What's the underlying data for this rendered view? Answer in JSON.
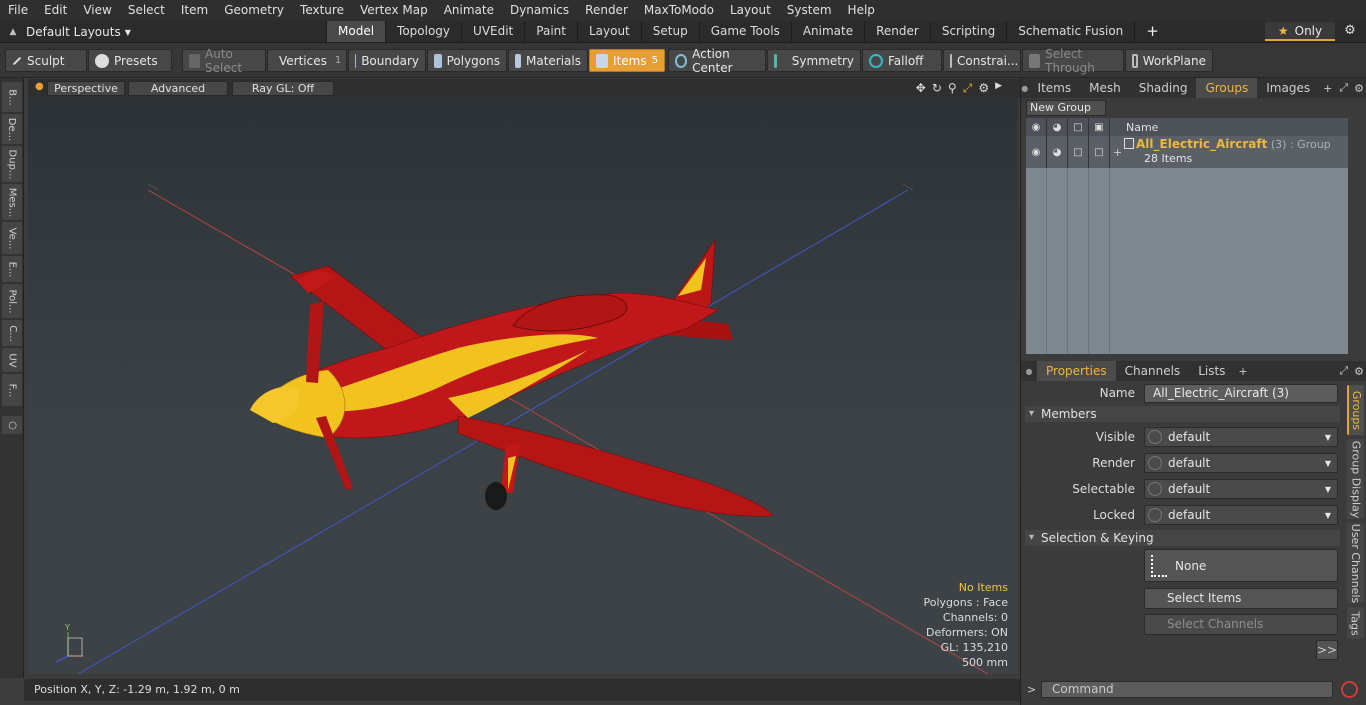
{
  "menu": [
    "File",
    "Edit",
    "View",
    "Select",
    "Item",
    "Geometry",
    "Texture",
    "Vertex Map",
    "Animate",
    "Dynamics",
    "Render",
    "MaxToModo",
    "Layout",
    "System",
    "Help"
  ],
  "layout_selector": "Default Layouts",
  "mode_tabs": [
    "Model",
    "Topology",
    "UVEdit",
    "Paint",
    "Layout",
    "Setup",
    "Game Tools",
    "Animate",
    "Render",
    "Scripting",
    "Schematic Fusion"
  ],
  "active_mode_tab": "Model",
  "only_label": "Only",
  "toolbar": {
    "sculpt": "Sculpt",
    "presets": "Presets",
    "auto_select": "Auto Select",
    "vertices": "Vertices",
    "vertices_count": "1",
    "boundary": "Boundary",
    "polygons": "Polygons",
    "materials": "Materials",
    "items": "Items",
    "items_count": "5",
    "action_center": "Action Center",
    "symmetry": "Symmetry",
    "falloff": "Falloff",
    "constraints": "Constrai...",
    "select_through": "Select Through",
    "workplane": "WorkPlane"
  },
  "left_tabs": [
    "B...",
    "De...",
    "Dup...",
    "Mes...",
    "Ve...",
    "E...",
    "Pol...",
    "C...",
    "UV",
    "F..."
  ],
  "viewport": {
    "perspective": "Perspective",
    "advanced": "Advanced",
    "raygl": "Ray GL: Off",
    "stats": {
      "items": "No Items",
      "polygons": "Polygons : Face",
      "channels": "Channels: 0",
      "deformers": "Deformers: ON",
      "gl": "GL: 135,210",
      "scale": "500 mm"
    }
  },
  "status": {
    "position": "Position X, Y, Z:   -1.29 m, 1.92 m, 0 m"
  },
  "right_tabs": [
    "Items",
    "Mesh ...",
    "Shading",
    "Groups",
    "Images"
  ],
  "active_right_tab": "Groups",
  "groups": {
    "new_group": "New Group",
    "name_header": "Name",
    "group_name": "All_Electric_Aircraft",
    "group_count": "(3)",
    "group_type": ": Group",
    "group_items": "28 Items"
  },
  "prop_tabs": [
    "Properties",
    "Channels",
    "Lists"
  ],
  "active_prop_tab": "Properties",
  "properties": {
    "name_label": "Name",
    "name_value": "All_Electric_Aircraft (3)",
    "members_section": "Members",
    "visible_label": "Visible",
    "visible_value": "default",
    "render_label": "Render",
    "render_value": "default",
    "selectable_label": "Selectable",
    "selectable_value": "default",
    "locked_label": "Locked",
    "locked_value": "default",
    "sel_keying_section": "Selection & Keying",
    "none_label": "None",
    "select_items": "Select Items",
    "select_channels": "Select Channels",
    "more": ">>"
  },
  "prop_vtabs": [
    "Groups",
    "Group Display",
    "User Channels",
    "Tags"
  ],
  "command_placeholder": "Command",
  "colors": {
    "accent": "#e79e34",
    "plane_red": "#b01515",
    "plane_yellow": "#f2c21f"
  }
}
